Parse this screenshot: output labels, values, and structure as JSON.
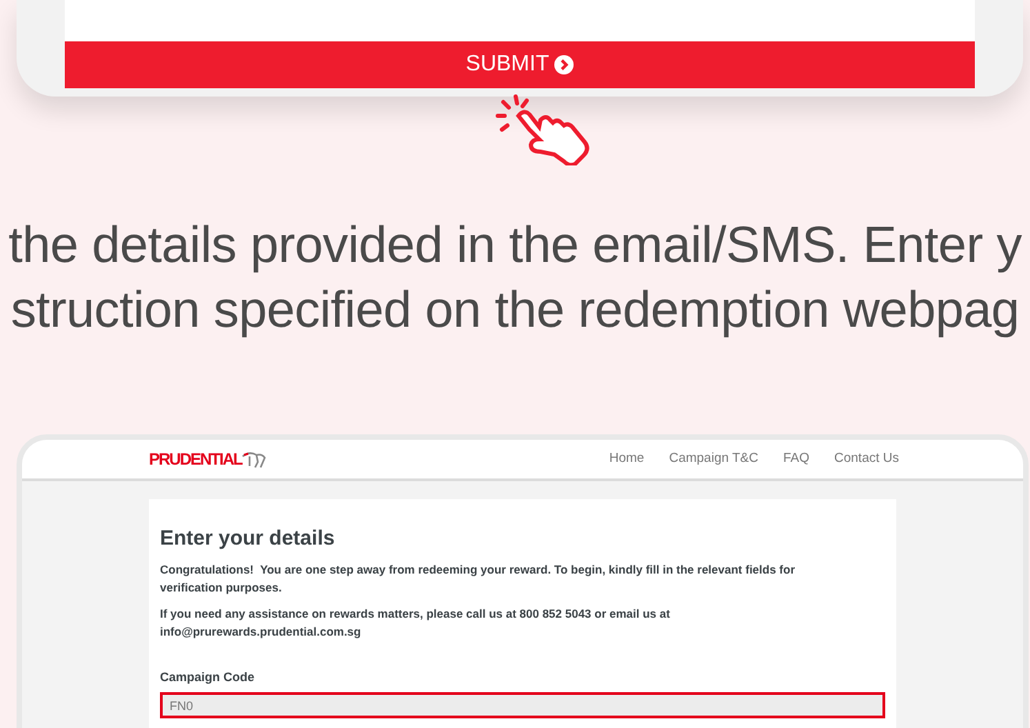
{
  "top_screen": {
    "submit_button": "SUBMIT"
  },
  "instruction": {
    "lines": [
      "the details provided in the email/SMS. Enter y",
      "struction specified on the redemption webpag"
    ]
  },
  "bottom_screen": {
    "logo": "PRUDENTIAL",
    "nav": [
      "Home",
      "Campaign T&C",
      "FAQ",
      "Contact Us"
    ],
    "form": {
      "title": "Enter your details",
      "paragraphs": [
        "Congratulations!  You are one step away from redeeming your reward. To begin, kindly fill in the relevant fields for verification purposes.",
        "If you need any assistance on rewards matters, please call us at 800 852 5043 or email us at info@prurewards.prudential.com.sg"
      ],
      "field_label": "Campaign Code",
      "field_value": "FN0",
      "field_highlighted": true
    }
  }
}
